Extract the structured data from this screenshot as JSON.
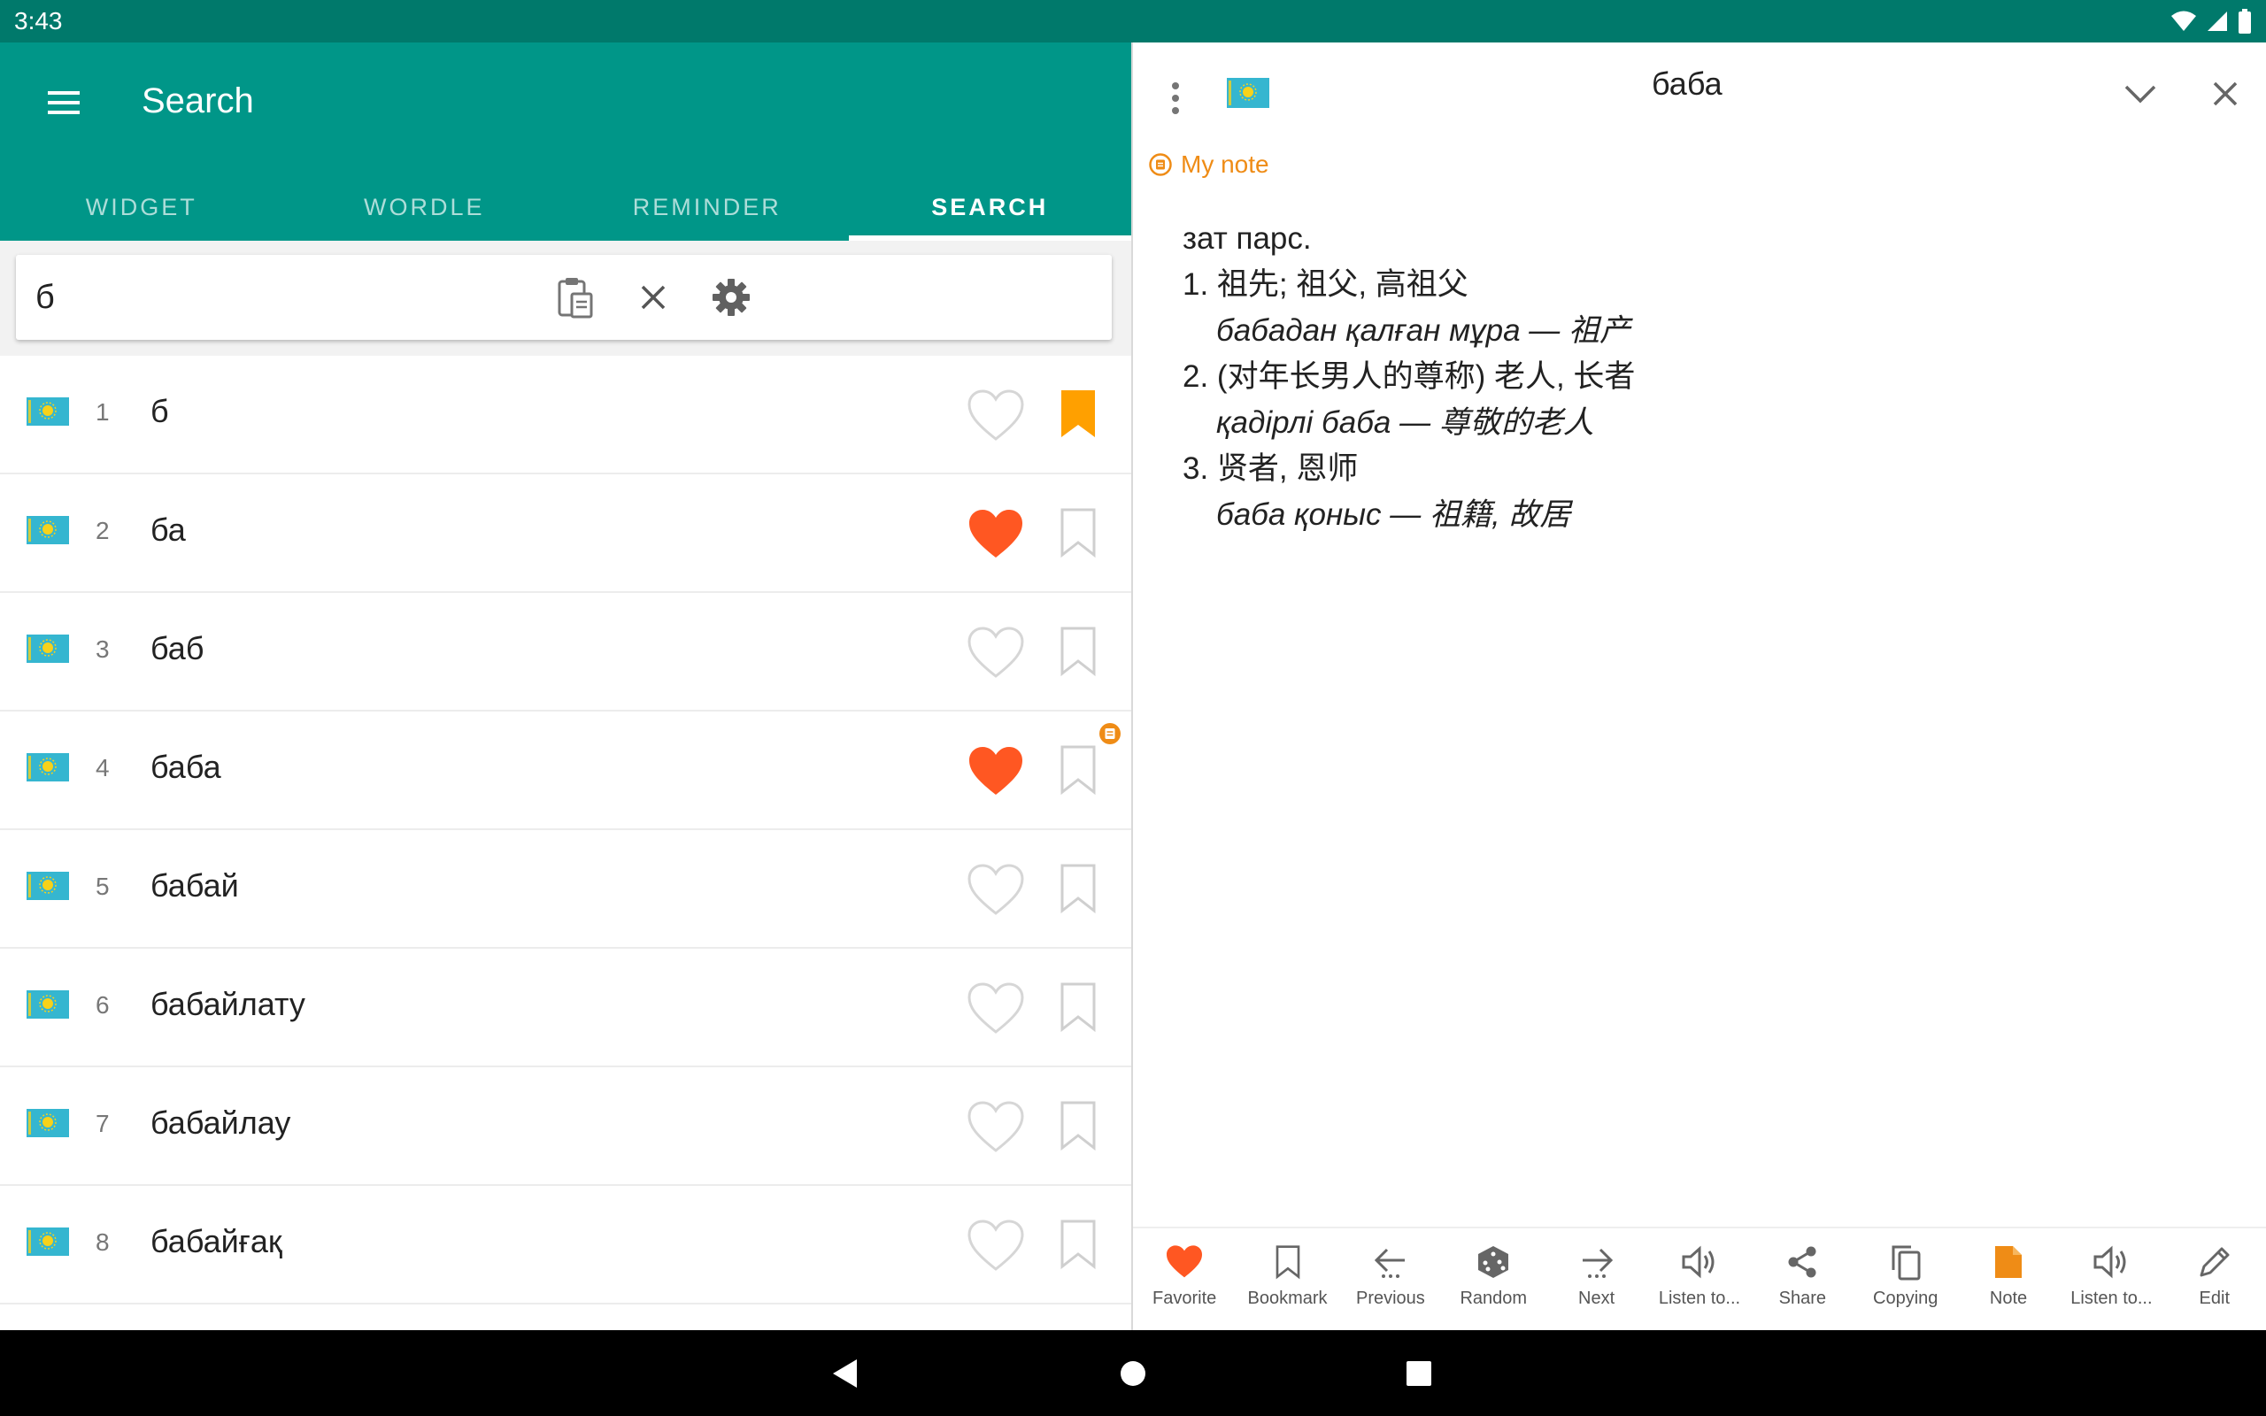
{
  "status_bar": {
    "time": "3:43"
  },
  "app_bar": {
    "title": "Search"
  },
  "tabs": [
    {
      "label": "WIDGET",
      "active": false
    },
    {
      "label": "WORDLE",
      "active": false
    },
    {
      "label": "REMINDER",
      "active": false
    },
    {
      "label": "SEARCH",
      "active": true
    }
  ],
  "search": {
    "value": "б"
  },
  "word_list": [
    {
      "num": "1",
      "word": "б",
      "favorite": false,
      "bookmarked": true
    },
    {
      "num": "2",
      "word": "ба",
      "favorite": true,
      "bookmarked": false
    },
    {
      "num": "3",
      "word": "баб",
      "favorite": false,
      "bookmarked": false
    },
    {
      "num": "4",
      "word": "баба",
      "favorite": true,
      "bookmarked": false,
      "has_note": true
    },
    {
      "num": "5",
      "word": "бабай",
      "favorite": false,
      "bookmarked": false
    },
    {
      "num": "6",
      "word": "бабайлату",
      "favorite": false,
      "bookmarked": false
    },
    {
      "num": "7",
      "word": "бабайлау",
      "favorite": false,
      "bookmarked": false
    },
    {
      "num": "8",
      "word": "бабайғақ",
      "favorite": false,
      "bookmarked": false
    }
  ],
  "detail": {
    "title": "баба",
    "note_label": "My note",
    "lines": [
      "зат парс.",
      "1. 祖先; 祖父, 高祖父",
      "бабадан қалған мұра — 祖产",
      "2. (对年长男人的尊称) 老人, 长者",
      "қадірлі баба — 尊敬的老人",
      "3. 贤者, 恩师",
      "баба қоныс — 祖籍, 故居"
    ]
  },
  "bottom_bar": [
    {
      "label": "Favorite",
      "icon": "heart-icon"
    },
    {
      "label": "Bookmark",
      "icon": "bookmark-icon"
    },
    {
      "label": "Previous",
      "icon": "arrow-left-icon"
    },
    {
      "label": "Random",
      "icon": "dice-icon"
    },
    {
      "label": "Next",
      "icon": "arrow-right-icon"
    },
    {
      "label": "Listen to...",
      "icon": "speaker-icon"
    },
    {
      "label": "Share",
      "icon": "share-icon"
    },
    {
      "label": "Copying",
      "icon": "copy-icon"
    },
    {
      "label": "Note",
      "icon": "note-icon"
    },
    {
      "label": "Listen to...",
      "icon": "speaker-icon"
    },
    {
      "label": "Edit",
      "icon": "pencil-icon"
    }
  ],
  "colors": {
    "primary": "#009688",
    "primary_dark": "#00796b",
    "favorite": "#ff5722",
    "bookmark_active": "#ffa000",
    "note": "#ef8c16"
  }
}
